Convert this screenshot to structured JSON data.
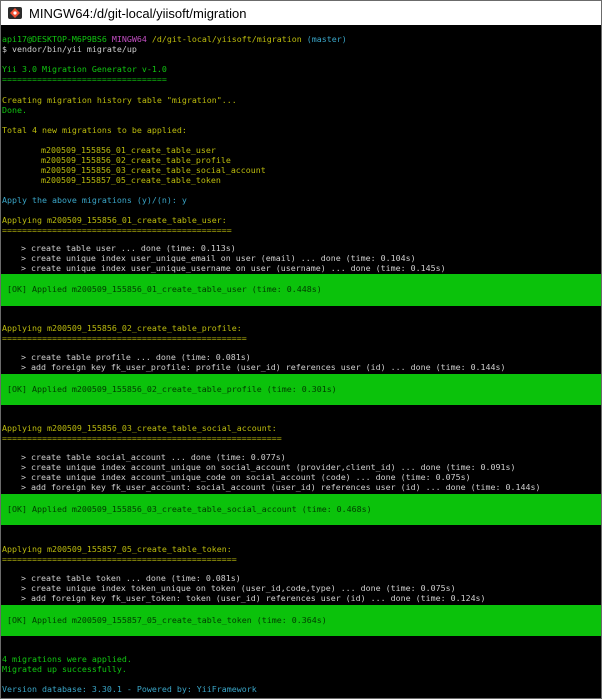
{
  "window": {
    "title": "MINGW64:/d/git-local/yiisoft/migration"
  },
  "prompt": {
    "user": "api17@DESKTOP-M6P9BS6",
    "shell": "MINGW64",
    "path": "/d/git-local/yiisoft/migration",
    "branch": "(master)"
  },
  "command": "$ vendor/bin/yii migrate/up",
  "header": {
    "title": "Yii 3.0 Migration Generator v-1.0",
    "underline": "================================="
  },
  "history": {
    "creating": "Creating migration history table \"migration\"...",
    "done": "Done."
  },
  "total": "Total 4 new migrations to be applied:",
  "list": [
    "m200509_155856_01_create_table_user",
    "m200509_155856_02_create_table_profile",
    "m200509_155856_03_create_table_social_account",
    "m200509_155857_05_create_table_token"
  ],
  "confirm": "Apply the above migrations (y)/(n): y",
  "blocks": [
    {
      "applying": "Applying m200509_155856_01_create_table_user:",
      "underline": "==============================================",
      "steps": [
        "> create table user ... done (time: 0.113s)",
        "> create unique index user_unique_email on user (email) ... done (time: 0.104s)",
        "> create unique index user_unique_username on user (username) ... done (time: 0.145s)"
      ],
      "ok": "[OK] Applied m200509_155856_01_create_table_user (time: 0.448s)"
    },
    {
      "applying": "Applying m200509_155856_02_create_table_profile:",
      "underline": "=================================================",
      "steps": [
        "> create table profile ... done (time: 0.081s)",
        "> add foreign key fk_user_profile: profile (user_id) references user (id) ... done (time: 0.144s)"
      ],
      "ok": "[OK] Applied m200509_155856_02_create_table_profile (time: 0.301s)"
    },
    {
      "applying": "Applying m200509_155856_03_create_table_social_account:",
      "underline": "========================================================",
      "steps": [
        "> create table social_account ... done (time: 0.077s)",
        "> create unique index account_unique on social_account (provider,client_id) ... done (time: 0.091s)",
        "> create unique index account_unique_code on social_account (code) ... done (time: 0.075s)",
        "> add foreign key fk_user_account: social_account (user_id) references user (id) ... done (time: 0.144s)"
      ],
      "ok": "[OK] Applied m200509_155856_03_create_table_social_account (time: 0.468s)"
    },
    {
      "applying": "Applying m200509_155857_05_create_table_token:",
      "underline": "===============================================",
      "steps": [
        "> create table token ... done (time: 0.081s)",
        "> create unique index token_unique on token (user_id,code,type) ... done (time: 0.075s)",
        "> add foreign key fk_user_token: token (user_id) references user (id) ... done (time: 0.124s)"
      ],
      "ok": "[OK] Applied m200509_155857_05_create_table_token (time: 0.364s)"
    }
  ],
  "footer": {
    "applied": "4 migrations were applied.",
    "success": "Migrated up successfully.",
    "version": "Version database: 3.30.1 - Powered by: YiiFramework"
  },
  "colors": {
    "green": "#11c611",
    "magenta": "#c34fc3",
    "yellow": "#bcbc0d",
    "cyan": "#3aa6c8",
    "ok_box": "#0bc20b"
  }
}
